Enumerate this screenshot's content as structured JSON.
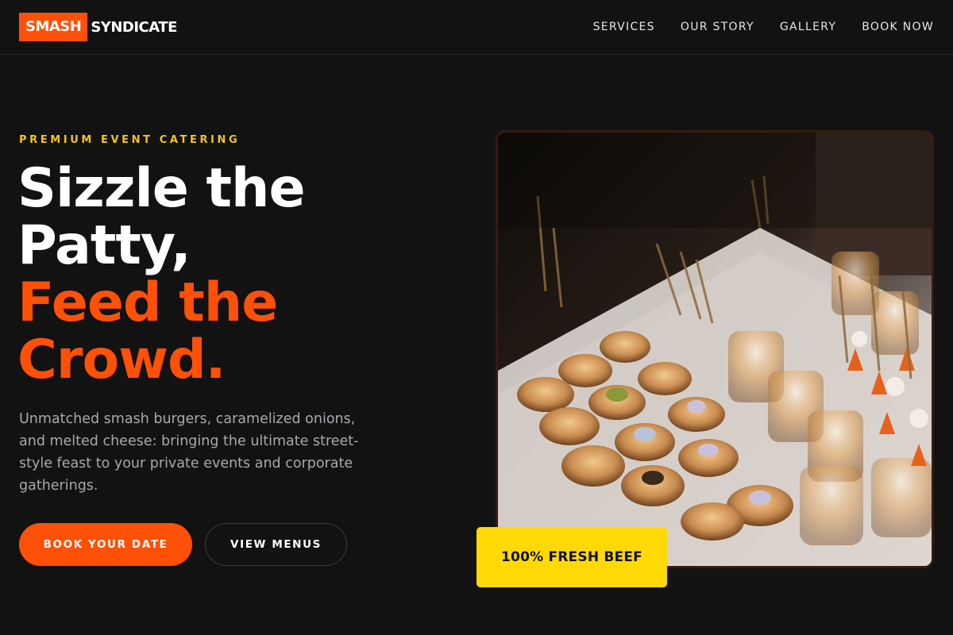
{
  "brand": {
    "part1": "SMASH",
    "part2": "SYNDICATE"
  },
  "nav": {
    "items": [
      "SERVICES",
      "OUR STORY",
      "GALLERY",
      "BOOK NOW"
    ]
  },
  "hero": {
    "eyebrow": "PREMIUM EVENT CATERING",
    "headline_line1": "Sizzle the",
    "headline_line2": "Patty,",
    "headline_line3": "Feed the",
    "headline_line4": "Crowd.",
    "lead": "Unmatched smash burgers, caramelized onions, and melted cheese: bringing the ultimate street-style feast to your private events and corporate gatherings.",
    "primary_cta": "BOOK YOUR DATE",
    "secondary_cta": "VIEW MENUS",
    "badge": "100% FRESH BEEF"
  },
  "colors": {
    "accent": "#ff5008",
    "highlight": "#ffd905",
    "eyebrow": "#f2c41c",
    "background": "#121213"
  }
}
